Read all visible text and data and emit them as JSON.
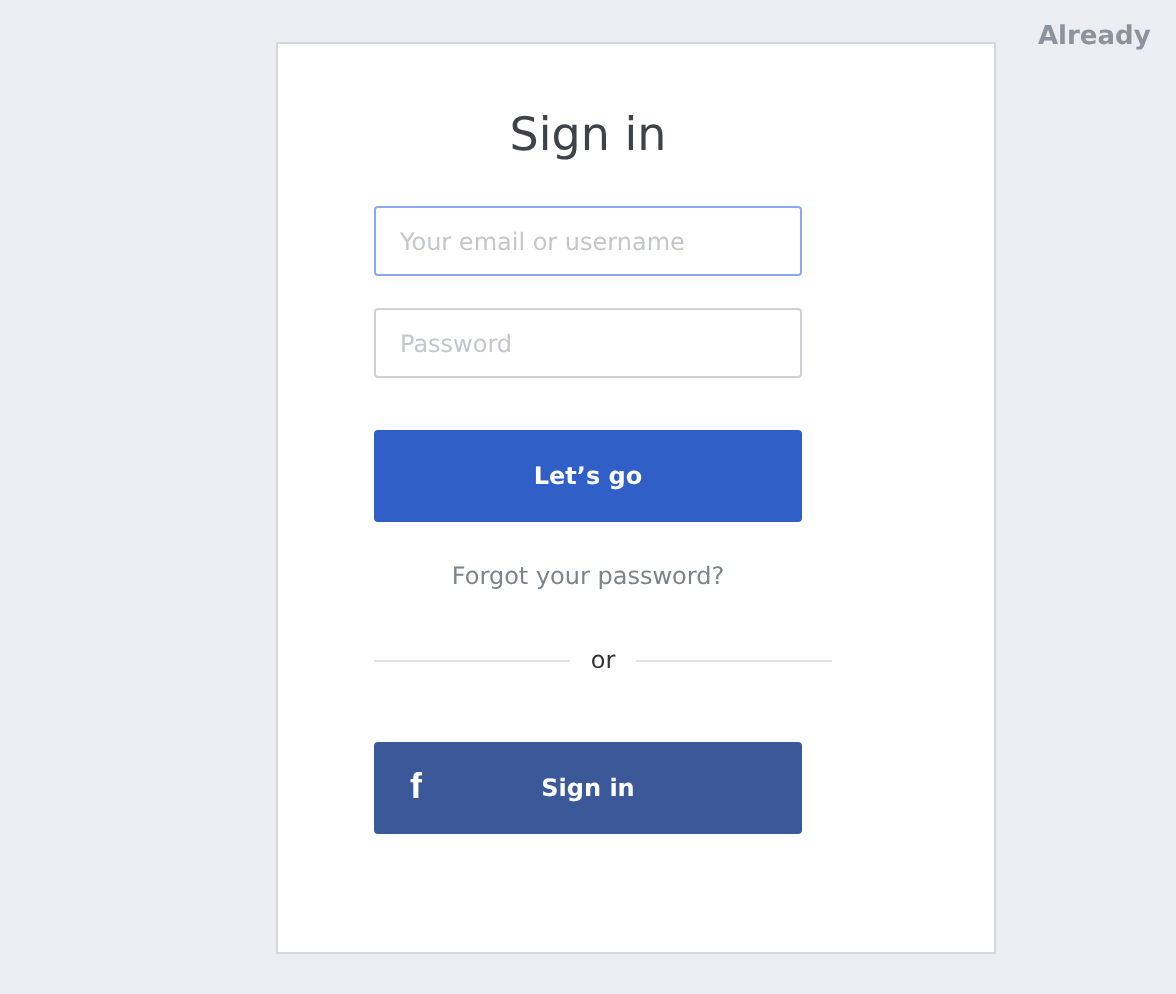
{
  "background_text": "Already",
  "title": "Sign in",
  "fields": [
    {
      "placeholder": "Your email or username",
      "focused": true
    },
    {
      "placeholder": "Password",
      "focused": false
    }
  ],
  "submit_button": "Let’s go",
  "forgot_link": "Forgot your password?",
  "divider_text": "or",
  "facebook_button": {
    "icon": "f",
    "label": "Sign in"
  }
}
